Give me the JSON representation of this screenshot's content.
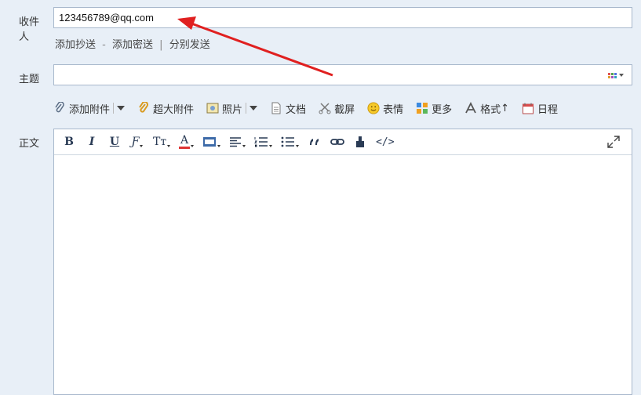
{
  "recipient": {
    "label": "收件人",
    "value": "123456789@qq.com",
    "add_cc": "添加抄送",
    "add_cc_sep": "-",
    "add_bcc": "添加密送",
    "links_sep": "|",
    "send_separately": "分别发送"
  },
  "subject": {
    "label": "主题",
    "value": ""
  },
  "attach_toolbar": {
    "attachment": "添加附件",
    "large_attachment": "超大附件",
    "photo": "照片",
    "document": "文档",
    "screenshot": "截屏",
    "emoji": "表情",
    "more": "更多",
    "format": "格式",
    "format_suffix": "↑",
    "schedule": "日程"
  },
  "body": {
    "label": "正文",
    "value": ""
  },
  "format_toolbar": {
    "bold": "B",
    "italic": "I",
    "underline": "U",
    "font": "Ƒ",
    "size": "Tт",
    "color": "A",
    "source": "</>"
  },
  "colors": {
    "background": "#e8eff7",
    "border": "#a8b8cc",
    "annotation_arrow": "#e02020"
  }
}
